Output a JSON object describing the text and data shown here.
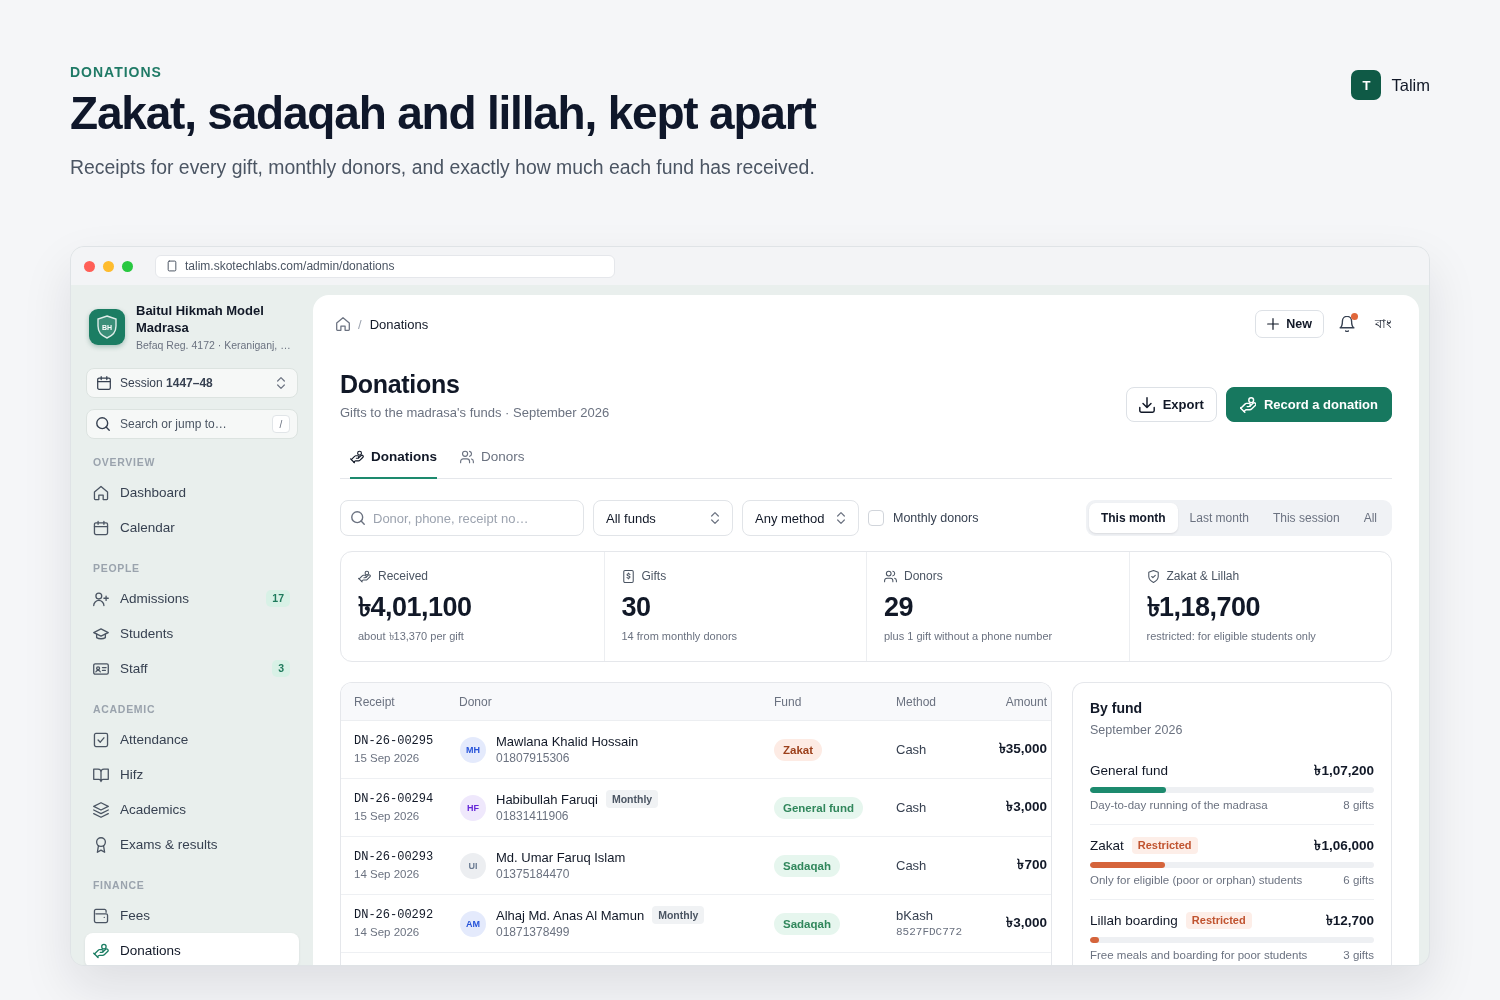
{
  "page_header": {
    "eyebrow": "DONATIONS",
    "title": "Zakat, sadaqah and lillah, kept apart",
    "subtitle": "Receipts for every gift, monthly donors, and exactly how much each fund has received."
  },
  "brand": {
    "initial": "T",
    "name": "Talim"
  },
  "browser": {
    "url": "talim.skotechlabs.com/admin/donations"
  },
  "sidebar": {
    "school": {
      "initials": "BH",
      "name": "Baitul Hikmah Model Madrasa",
      "meta": "Befaq Reg. 4172 · Keraniganj, …"
    },
    "session": "Session **1447–48**",
    "search": {
      "placeholder": "Search or jump to…",
      "shortcut": "/"
    },
    "sections": [
      {
        "heading": "OVERVIEW",
        "items": [
          {
            "label": "Dashboard",
            "selected": false
          },
          {
            "label": "Calendar",
            "selected": false
          }
        ]
      },
      {
        "heading": "PEOPLE",
        "items": [
          {
            "label": "Admissions",
            "badge": "17",
            "selected": false
          },
          {
            "label": "Students",
            "selected": false
          },
          {
            "label": "Staff",
            "badge": "3",
            "selected": false
          }
        ]
      },
      {
        "heading": "ACADEMIC",
        "items": [
          {
            "label": "Attendance",
            "selected": false
          },
          {
            "label": "Hifz",
            "selected": false
          },
          {
            "label": "Academics",
            "selected": false
          },
          {
            "label": "Exams & results",
            "selected": false
          }
        ]
      },
      {
        "heading": "FINANCE",
        "items": [
          {
            "label": "Fees",
            "selected": false
          },
          {
            "label": "Donations",
            "selected": true
          }
        ]
      }
    ]
  },
  "topbar": {
    "breadcrumb": {
      "separator": "/",
      "current": "Donations"
    },
    "new_button": "New",
    "notifications": {
      "unread": true
    },
    "language": "বাং"
  },
  "page": {
    "title": "Donations",
    "subtitle": "Gifts to the madrasa's funds · September 2026",
    "actions": [
      {
        "label": "Export",
        "kind": "secondary"
      },
      {
        "label": "Record a donation",
        "kind": "primary"
      }
    ]
  },
  "tabs": [
    {
      "label": "Donations",
      "selected": true
    },
    {
      "label": "Donors",
      "selected": false
    }
  ],
  "filters": {
    "search": {
      "placeholder": "Donor, phone, receipt no…"
    },
    "fund": "All funds",
    "method": "Any method",
    "monthly_donors": {
      "label": "Monthly donors",
      "checked": false
    },
    "periods": [
      {
        "label": "This month",
        "selected": true
      },
      {
        "label": "Last month",
        "selected": false
      },
      {
        "label": "This session",
        "selected": false
      },
      {
        "label": "All",
        "selected": false
      }
    ]
  },
  "stats": [
    {
      "label": "Received",
      "value": "৳4,01,100",
      "note": "about ৳13,370 per gift"
    },
    {
      "label": "Gifts",
      "value": "30",
      "note": "14 from monthly donors"
    },
    {
      "label": "Donors",
      "value": "29",
      "note": "plus 1 gift without a phone number"
    },
    {
      "label": "Zakat & Lillah",
      "value": "৳1,18,700",
      "note": "restricted: for eligible students only"
    }
  ],
  "table": {
    "columns": [
      "Receipt",
      "Donor",
      "Fund",
      "Method",
      "Amount"
    ],
    "rows": [
      {
        "receipt": "DN-26-00295",
        "date": "15 Sep 2026",
        "avatar": {
          "initials": "MH",
          "color": "#e4eafc"
        },
        "donor": "Mawlana Khalid Hossain",
        "phone": "01807915306",
        "fund": {
          "label": "Zakat",
          "color": "#fdebe4"
        },
        "method": "Cash",
        "amount": "৳35,000"
      },
      {
        "receipt": "DN-26-00294",
        "date": "15 Sep 2026",
        "avatar": {
          "initials": "HF",
          "color": "#efe8fc"
        },
        "donor": "Habibullah Faruqi",
        "tag": "Monthly",
        "phone": "01831411906",
        "fund": {
          "label": "General fund",
          "color": "#e6f6ee"
        },
        "method": "Cash",
        "amount": "৳3,000"
      },
      {
        "receipt": "DN-26-00293",
        "date": "14 Sep 2026",
        "avatar": {
          "initials": "UI",
          "color": "#eceef1"
        },
        "donor": "Md. Umar Faruq Islam",
        "phone": "01375184470",
        "fund": {
          "label": "Sadaqah",
          "color": "#e6f6ee"
        },
        "method": "Cash",
        "amount": "৳700"
      },
      {
        "receipt": "DN-26-00292",
        "date": "14 Sep 2026",
        "avatar": {
          "initials": "AM",
          "color": "#e4eafc"
        },
        "donor": "Alhaj Md. Anas Al Mamun",
        "tag": "Monthly",
        "phone": "01871378499",
        "fund": {
          "label": "Sadaqah",
          "color": "#e6f6ee"
        },
        "method": "bKash",
        "reference": "8527FDC772",
        "amount": "৳3,000"
      }
    ]
  },
  "by_fund": {
    "title": "By fund",
    "subtitle": "September 2026",
    "funds": [
      {
        "name": "General fund",
        "amount": "৳1,07,200",
        "level": 0.267,
        "color": "#1d8a6e",
        "description": "Day-to-day running of the madrasa",
        "gifts": "8 gifts"
      },
      {
        "name": "Zakat",
        "tag": "Restricted",
        "amount": "৳1,06,000",
        "level": 0.264,
        "color": "#d5643b",
        "description": "Only for eligible (poor or orphan) students",
        "gifts": "6 gifts"
      },
      {
        "name": "Lillah boarding",
        "tag": "Restricted",
        "amount": "৳12,700",
        "level": 0.032,
        "color": "#d5643b",
        "description": "Free meals and boarding for poor students",
        "gifts": "3 gifts"
      }
    ]
  }
}
